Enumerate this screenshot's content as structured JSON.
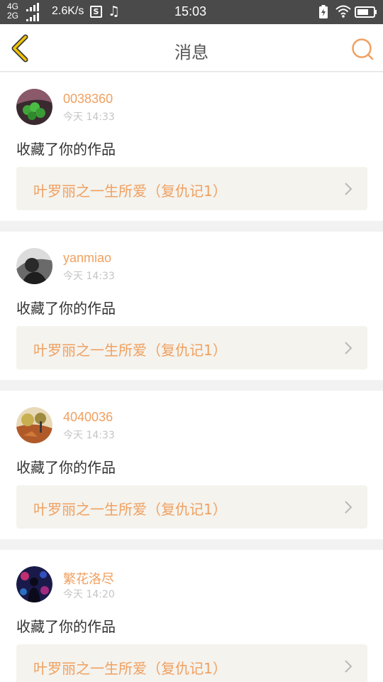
{
  "status_bar": {
    "network_top": "4G",
    "network_bottom": "2G",
    "speed": "2.6K/s",
    "s_badge": "S",
    "time": "15:03"
  },
  "header": {
    "title": "消息",
    "icons": {
      "back": "back-chevron-icon",
      "search": "search-icon"
    }
  },
  "colors": {
    "accent": "#f0a060",
    "status_bar_bg": "#4a4a4a",
    "card_bg": "#ffffff",
    "work_bg": "#f4f3ee",
    "page_bg": "#f2f2f2"
  },
  "messages": [
    {
      "username": "0038360",
      "time": "今天 14:33",
      "action": "收藏了你的作品",
      "work_title": "叶罗丽之一生所爱（复仇记1）"
    },
    {
      "username": "yanmiao",
      "time": "今天 14:33",
      "action": "收藏了你的作品",
      "work_title": "叶罗丽之一生所爱（复仇记1）"
    },
    {
      "username": "4040036",
      "time": "今天 14:33",
      "action": "收藏了你的作品",
      "work_title": "叶罗丽之一生所爱（复仇记1）"
    },
    {
      "username": "繁花洛尽",
      "time": "今天 14:20",
      "action": "收藏了你的作品",
      "work_title": "叶罗丽之一生所爱（复仇记1）"
    }
  ]
}
